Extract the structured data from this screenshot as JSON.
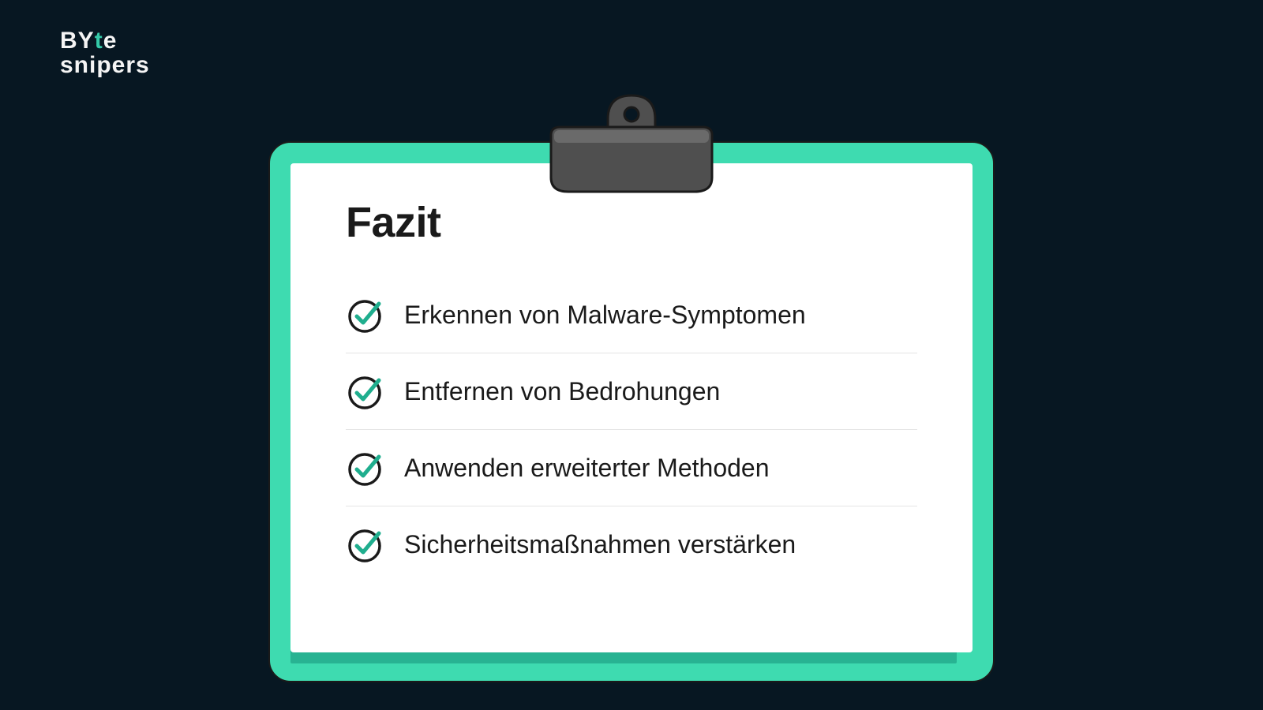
{
  "logo": {
    "line1_pre": "BY",
    "line1_accent": "t",
    "line1_post": "e",
    "line2_pre": "sn",
    "line2_accent": "i",
    "line2_post": "pers"
  },
  "card": {
    "title": "Fazit",
    "items": [
      {
        "label": "Erkennen von Malware-Symptomen"
      },
      {
        "label": "Entfernen von Bedrohungen"
      },
      {
        "label": "Anwenden erweiterter Methoden"
      },
      {
        "label": "Sicherheitsmaßnahmen verstärken"
      }
    ]
  },
  "colors": {
    "background": "#071722",
    "board": "#3edbb0",
    "accent": "#1fae8e",
    "text": "#1a1a1a",
    "logo_accent": "#34c9a8"
  }
}
